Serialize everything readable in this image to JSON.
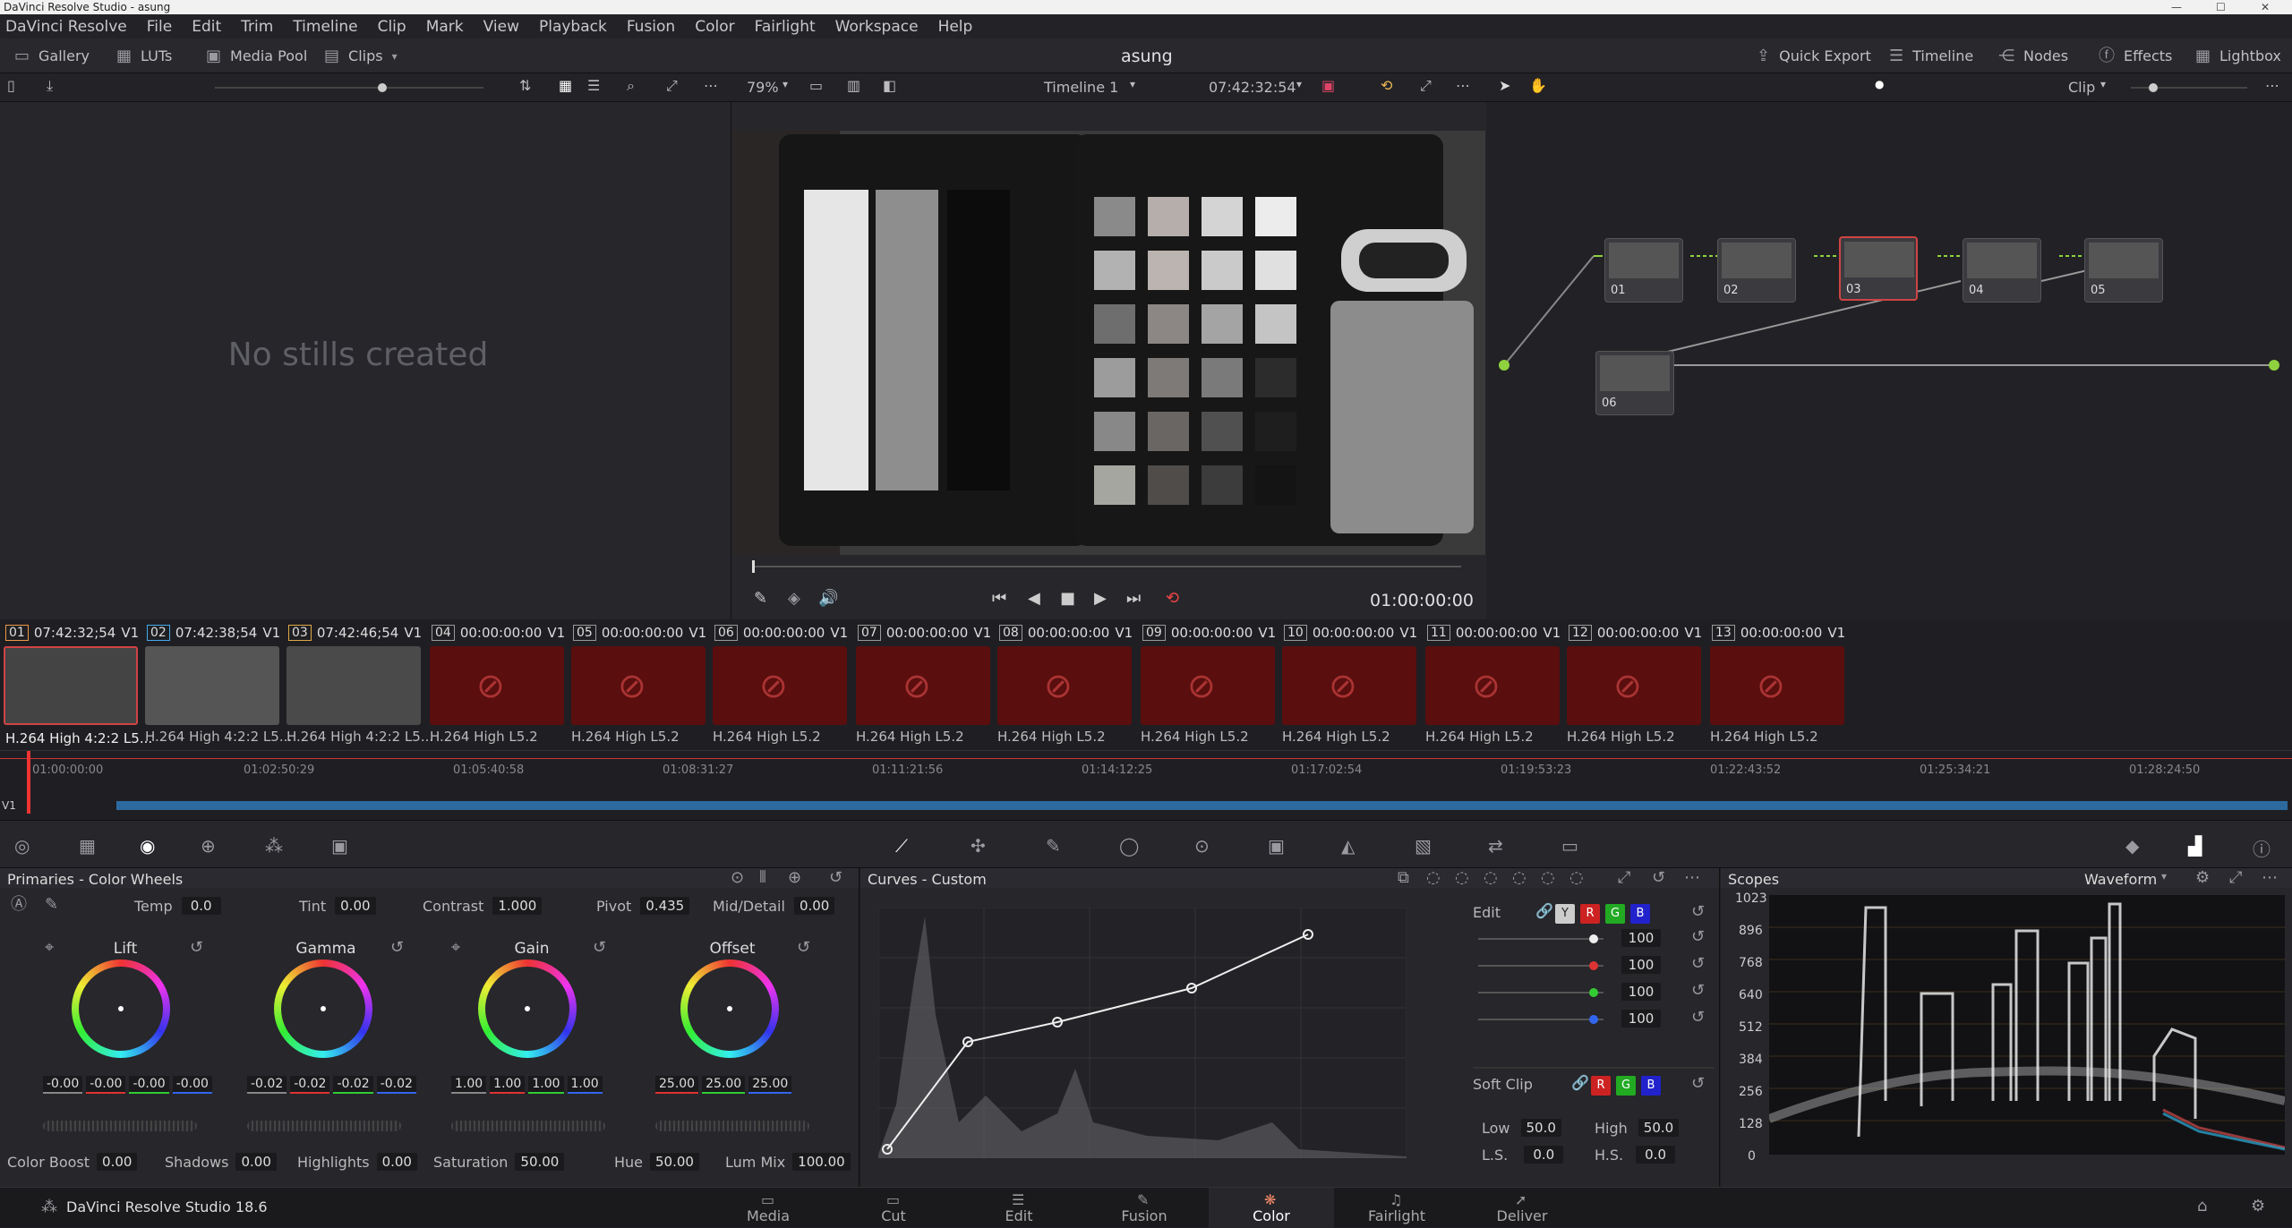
{
  "window": {
    "title": "DaVinci Resolve Studio - asung"
  },
  "menu": [
    "DaVinci Resolve",
    "File",
    "Edit",
    "Trim",
    "Timeline",
    "Clip",
    "Mark",
    "View",
    "Playback",
    "Fusion",
    "Color",
    "Fairlight",
    "Workspace",
    "Help"
  ],
  "toolbar": {
    "gallery": "Gallery",
    "luts": "LUTs",
    "media_pool": "Media Pool",
    "clips": "Clips",
    "project": "asung",
    "quick_export": "Quick Export",
    "timeline": "Timeline",
    "nodes": "Nodes",
    "effects": "Effects",
    "lightbox": "Lightbox"
  },
  "viewer_toolbar": {
    "zoom": "79%",
    "timeline_name": "Timeline 1",
    "timecode": "07:42:32:54",
    "mode": "Clip"
  },
  "gallery": {
    "empty": "No stills created"
  },
  "transport": {
    "timecode": "01:00:00:00"
  },
  "nodes": [
    "01",
    "02",
    "03",
    "04",
    "05",
    "06"
  ],
  "clips": [
    {
      "num": "01",
      "tc": "07:42:32;54",
      "track": "V1",
      "codec": "H.264 High 4:2:2 L5..."
    },
    {
      "num": "02",
      "tc": "07:42:38;54",
      "track": "V1",
      "codec": "H.264 High 4:2:2 L5..."
    },
    {
      "num": "03",
      "tc": "07:42:46;54",
      "track": "V1",
      "codec": "H.264 High 4:2:2 L5..."
    },
    {
      "num": "04",
      "tc": "00:00:00:00",
      "track": "V1",
      "codec": "H.264 High L5.2"
    },
    {
      "num": "05",
      "tc": "00:00:00:00",
      "track": "V1",
      "codec": "H.264 High L5.2"
    },
    {
      "num": "06",
      "tc": "00:00:00:00",
      "track": "V1",
      "codec": "H.264 High L5.2"
    },
    {
      "num": "07",
      "tc": "00:00:00:00",
      "track": "V1",
      "codec": "H.264 High L5.2"
    },
    {
      "num": "08",
      "tc": "00:00:00:00",
      "track": "V1",
      "codec": "H.264 High L5.2"
    },
    {
      "num": "09",
      "tc": "00:00:00:00",
      "track": "V1",
      "codec": "H.264 High L5.2"
    },
    {
      "num": "10",
      "tc": "00:00:00:00",
      "track": "V1",
      "codec": "H.264 High L5.2"
    },
    {
      "num": "11",
      "tc": "00:00:00:00",
      "track": "V1",
      "codec": "H.264 High L5.2"
    },
    {
      "num": "12",
      "tc": "00:00:00:00",
      "track": "V1",
      "codec": "H.264 High L5.2"
    },
    {
      "num": "13",
      "tc": "00:00:00:00",
      "track": "V1",
      "codec": "H.264 High L5.2"
    }
  ],
  "timeline_ticks": [
    "01:00:00:00",
    "01:02:50:29",
    "01:05:40:58",
    "01:08:31:27",
    "01:11:21:56",
    "01:14:12:25",
    "01:17:02:54",
    "01:19:53:23",
    "01:22:43:52",
    "01:25:34:21",
    "01:28:24:50"
  ],
  "timeline_track": "V1",
  "primaries": {
    "title": "Primaries - Color Wheels",
    "temp_label": "Temp",
    "temp": "0.0",
    "tint_label": "Tint",
    "tint": "0.00",
    "contrast_label": "Contrast",
    "contrast": "1.000",
    "pivot_label": "Pivot",
    "pivot": "0.435",
    "middetail_label": "Mid/Detail",
    "middetail": "0.00",
    "wheels": [
      {
        "name": "Lift",
        "values": [
          "-0.00",
          "-0.00",
          "-0.00",
          "-0.00"
        ]
      },
      {
        "name": "Gamma",
        "values": [
          "-0.02",
          "-0.02",
          "-0.02",
          "-0.02"
        ]
      },
      {
        "name": "Gain",
        "values": [
          "1.00",
          "1.00",
          "1.00",
          "1.00"
        ]
      },
      {
        "name": "Offset",
        "values": [
          "25.00",
          "25.00",
          "25.00"
        ]
      }
    ],
    "colorboost_label": "Color Boost",
    "colorboost": "0.00",
    "shadows_label": "Shadows",
    "shadows": "0.00",
    "highlights_label": "Highlights",
    "highlights": "0.00",
    "saturation_label": "Saturation",
    "saturation": "50.00",
    "hue_label": "Hue",
    "hue": "50.00",
    "lummix_label": "Lum Mix",
    "lummix": "100.00"
  },
  "curves": {
    "title": "Curves - Custom",
    "edit_label": "Edit",
    "intensities": [
      "100",
      "100",
      "100",
      "100"
    ],
    "softclip_label": "Soft Clip",
    "low_label": "Low",
    "low": "50.0",
    "high_label": "High",
    "high": "50.0",
    "ls_label": "L.S.",
    "ls": "0.0",
    "hs_label": "H.S.",
    "hs": "0.0",
    "channels": [
      "Y",
      "R",
      "G",
      "B"
    ]
  },
  "scopes": {
    "title": "Scopes",
    "mode": "Waveform",
    "ticks": [
      "1023",
      "896",
      "768",
      "640",
      "512",
      "384",
      "256",
      "128",
      "0"
    ]
  },
  "footer": {
    "app": "DaVinci Resolve Studio 18.6",
    "pages": [
      "Media",
      "Cut",
      "Edit",
      "Fusion",
      "Color",
      "Fairlight",
      "Deliver"
    ],
    "active": "Color"
  },
  "colors": {
    "accent": "#d04444",
    "node_green": "#8fd13f",
    "node_blue": "#2ea6ff"
  }
}
